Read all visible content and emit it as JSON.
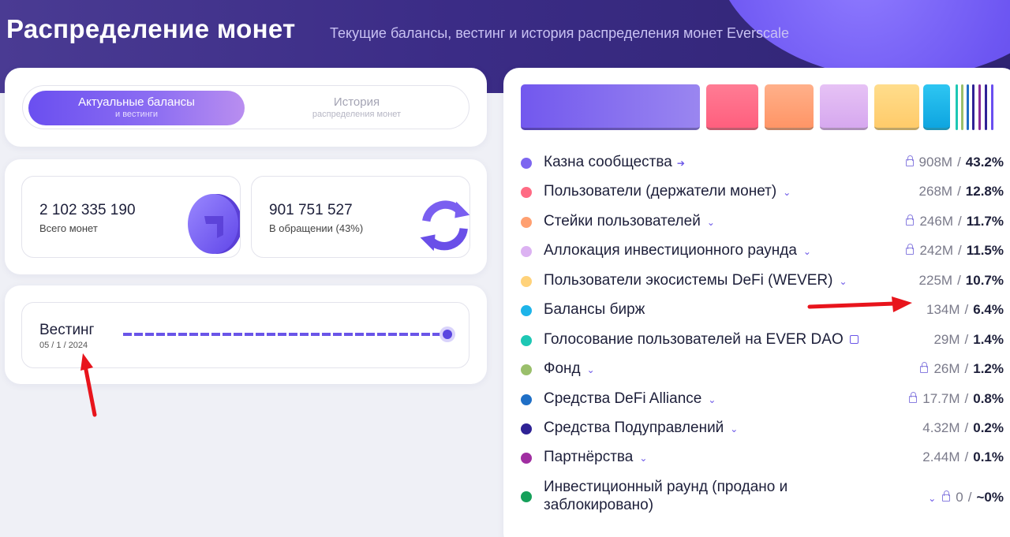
{
  "header": {
    "title": "Распределение монет",
    "subtitle": "Текущие балансы, вестинг и история распределения монет Everscale"
  },
  "tabs": [
    {
      "label": "Актуальные балансы",
      "sublabel": "и вестинги",
      "active": true
    },
    {
      "label": "История",
      "sublabel": "распределения монет",
      "active": false
    }
  ],
  "stats": [
    {
      "value": "2 102 335 190",
      "label": "Всего монет",
      "icon": "coin-arrow-icon"
    },
    {
      "value": "901 751 527",
      "label": "В обращении (43%)",
      "icon": "coin-refresh-icon"
    }
  ],
  "vesting": {
    "title": "Вестинг",
    "date": "05 / 1 / 2024",
    "progress": 1.0
  },
  "distribution": {
    "bars": [
      {
        "color": "#7d66f0",
        "share": 43.2
      },
      {
        "color": "#ff6b84",
        "share": 12.8
      },
      {
        "color": "#ffa071",
        "share": 11.7
      },
      {
        "color": "#dcb2f2",
        "share": 11.5
      },
      {
        "color": "#ffd27a",
        "share": 10.7
      },
      {
        "color": "#1eb4e9",
        "share": 6.4
      },
      {
        "color": "#1ec7b4",
        "share": 1.4
      },
      {
        "color": "#9abf6b",
        "share": 1.2
      },
      {
        "color": "#1f6fc6",
        "share": 0.8
      },
      {
        "color": "#2f2295",
        "share": 0.2
      },
      {
        "color": "#a02ea1",
        "share": 0.1
      }
    ],
    "items": [
      {
        "label": "Казна сообщества",
        "amount": "908M",
        "percent": "43.2%",
        "color": "#7d66f0",
        "locked": true,
        "marker": "arrow-right-icon"
      },
      {
        "label": "Пользователи (держатели монет)",
        "amount": "268M",
        "percent": "12.8%",
        "color": "#ff6b84",
        "locked": false,
        "marker": "chevron-down-icon"
      },
      {
        "label": "Стейки пользователей",
        "amount": "246M",
        "percent": "11.7%",
        "color": "#ffa071",
        "locked": true,
        "marker": "chevron-down-icon"
      },
      {
        "label": "Аллокация инвестиционного раунда",
        "amount": "242M",
        "percent": "11.5%",
        "color": "#dcb2f2",
        "locked": true,
        "marker": "chevron-down-icon"
      },
      {
        "label": "Пользователи экосистемы DeFi (WEVER)",
        "amount": "225M",
        "percent": "10.7%",
        "color": "#ffd27a",
        "locked": false,
        "marker": "chevron-down-icon"
      },
      {
        "label": "Балансы бирж",
        "amount": "134M",
        "percent": "6.4%",
        "color": "#1eb4e9",
        "locked": false,
        "marker": ""
      },
      {
        "label": "Голосование пользователей на EVER DAO",
        "amount": "29M",
        "percent": "1.4%",
        "color": "#1ec7b4",
        "locked": false,
        "marker": "external-link-icon"
      },
      {
        "label": "Фонд",
        "amount": "26M",
        "percent": "1.2%",
        "color": "#9abf6b",
        "locked": true,
        "marker": "chevron-down-icon"
      },
      {
        "label": "Средства DeFi Alliance",
        "amount": "17.7M",
        "percent": "0.8%",
        "color": "#1f6fc6",
        "locked": true,
        "marker": "chevron-down-icon"
      },
      {
        "label": "Средства Подуправлений",
        "amount": "4.32M",
        "percent": "0.2%",
        "color": "#2f2295",
        "locked": false,
        "marker": "chevron-down-icon"
      },
      {
        "label": "Партнёрства",
        "amount": "2.44M",
        "percent": "0.1%",
        "color": "#a02ea1",
        "locked": false,
        "marker": "chevron-down-icon"
      },
      {
        "label": "Инвестиционный раунд (продано и заблокировано)",
        "amount": "0",
        "percent": "~0%",
        "color": "#16a05a",
        "locked": true,
        "marker": "chevron-down-icon"
      }
    ],
    "separator": "/"
  }
}
